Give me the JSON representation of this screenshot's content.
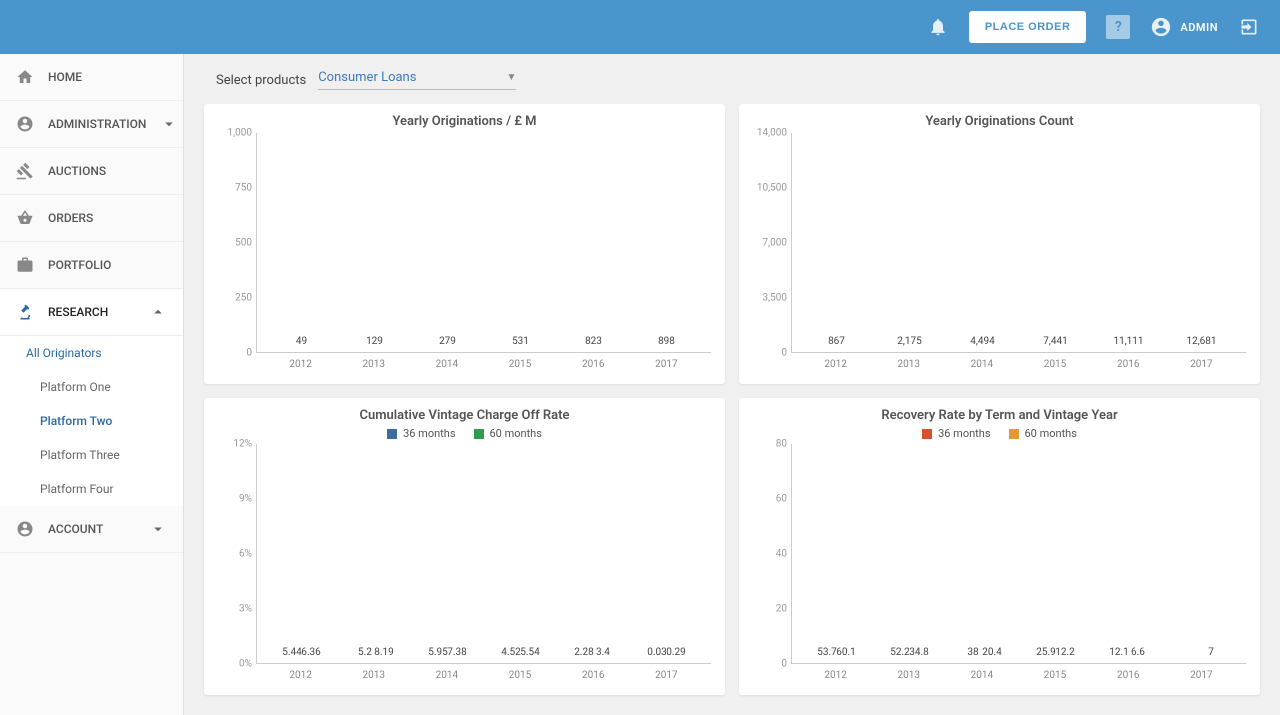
{
  "topbar": {
    "place_order": "PLACE ORDER",
    "user_label": "ADMIN"
  },
  "sidebar": {
    "items": [
      {
        "key": "home",
        "label": "HOME"
      },
      {
        "key": "administration",
        "label": "ADMINISTRATION",
        "expandable": true,
        "expanded": false
      },
      {
        "key": "auctions",
        "label": "AUCTIONS"
      },
      {
        "key": "orders",
        "label": "ORDERS"
      },
      {
        "key": "portfolio",
        "label": "PORTFOLIO"
      },
      {
        "key": "research",
        "label": "RESEARCH",
        "expandable": true,
        "expanded": true,
        "children": [
          {
            "label": "All Originators",
            "children": [
              {
                "label": "Platform One"
              },
              {
                "label": "Platform Two",
                "selected": true
              },
              {
                "label": "Platform Three"
              },
              {
                "label": "Platform Four"
              }
            ]
          }
        ]
      },
      {
        "key": "account",
        "label": "ACCOUNT",
        "expandable": true,
        "expanded": false
      }
    ]
  },
  "filter": {
    "label": "Select products",
    "selected": "Consumer Loans"
  },
  "chart_data": [
    {
      "type": "bar",
      "title": "Yearly Originations / £ M",
      "categories": [
        "2012",
        "2013",
        "2014",
        "2015",
        "2016",
        "2017"
      ],
      "values": [
        49,
        129,
        279,
        531,
        823,
        898
      ],
      "ylim": [
        0,
        1000
      ],
      "yticks": [
        0,
        250,
        500,
        750,
        1000
      ],
      "highlight_last": true,
      "colors": {
        "primary": "#3b6e9e",
        "highlight": "#a6c6dd"
      }
    },
    {
      "type": "bar",
      "title": "Yearly Originations Count",
      "categories": [
        "2012",
        "2013",
        "2014",
        "2015",
        "2016",
        "2017"
      ],
      "values": [
        867,
        2175,
        4494,
        7441,
        11111,
        12681
      ],
      "ylim": [
        0,
        14000
      ],
      "yticks": [
        0,
        3500,
        7000,
        10500,
        14000
      ],
      "highlight_last": true,
      "colors": {
        "primary": "#3b6e9e",
        "highlight": "#a6c6dd"
      }
    },
    {
      "type": "bar",
      "title": "Cumulative Vintage Charge Off Rate",
      "categories": [
        "2012",
        "2013",
        "2014",
        "2015",
        "2016",
        "2017"
      ],
      "series": [
        {
          "name": "36 months",
          "color": "#3b6e9e",
          "values": [
            5.44,
            5.2,
            5.95,
            4.52,
            2.28,
            0.03
          ]
        },
        {
          "name": "60 months",
          "color": "#2e9b4f",
          "values": [
            6.36,
            8.19,
            7.38,
            5.54,
            3.4,
            0.29
          ]
        }
      ],
      "ylim": [
        0,
        12
      ],
      "yticks": [
        0,
        3,
        6,
        9,
        12
      ],
      "y_suffix": "%",
      "highlight_last": true
    },
    {
      "type": "bar",
      "title": "Recovery Rate by Term and Vintage Year",
      "categories": [
        "2012",
        "2013",
        "2014",
        "2015",
        "2016",
        "2017"
      ],
      "series": [
        {
          "name": "36 months",
          "color": "#d9502f",
          "values": [
            53.7,
            52.2,
            38,
            25.9,
            12.1,
            null
          ]
        },
        {
          "name": "60 months",
          "color": "#e69a35",
          "values": [
            60.1,
            34.8,
            20.4,
            12.2,
            6.6,
            7
          ]
        }
      ],
      "ylim": [
        0,
        80
      ],
      "yticks": [
        0,
        20,
        40,
        60,
        80
      ],
      "highlight_last": true
    }
  ]
}
